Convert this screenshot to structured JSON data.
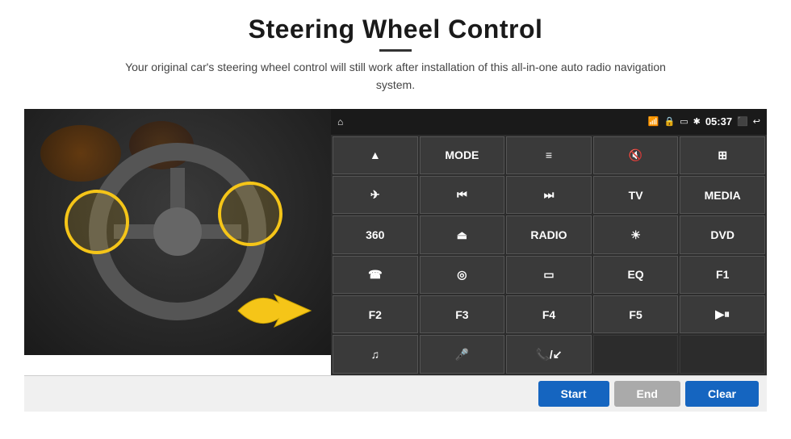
{
  "page": {
    "title": "Steering Wheel Control",
    "subtitle": "Your original car's steering wheel control will still work after installation of this all-in-one auto radio navigation system.",
    "divider": true
  },
  "topbar": {
    "wifi_icon": "wifi",
    "lock_icon": "lock",
    "sim_icon": "sim",
    "bt_icon": "bluetooth",
    "time": "05:37",
    "screen_icon": "screen",
    "back_icon": "back",
    "home_icon": "home"
  },
  "control_buttons": [
    {
      "id": "nav",
      "label": "▲",
      "type": "icon"
    },
    {
      "id": "mode",
      "label": "MODE",
      "type": "text"
    },
    {
      "id": "list",
      "label": "≡",
      "type": "icon"
    },
    {
      "id": "mute",
      "label": "🔇",
      "type": "icon"
    },
    {
      "id": "apps",
      "label": "⊞",
      "type": "icon"
    },
    {
      "id": "back-nav",
      "label": "✈",
      "type": "icon"
    },
    {
      "id": "prev",
      "label": "⏮",
      "type": "icon"
    },
    {
      "id": "next",
      "label": "⏭",
      "type": "icon"
    },
    {
      "id": "tv",
      "label": "TV",
      "type": "text"
    },
    {
      "id": "media",
      "label": "MEDIA",
      "type": "text"
    },
    {
      "id": "cam360",
      "label": "360",
      "type": "text"
    },
    {
      "id": "eject",
      "label": "⏏",
      "type": "icon"
    },
    {
      "id": "radio",
      "label": "RADIO",
      "type": "text"
    },
    {
      "id": "bright",
      "label": "☀",
      "type": "icon"
    },
    {
      "id": "dvd",
      "label": "DVD",
      "type": "text"
    },
    {
      "id": "phone",
      "label": "☎",
      "type": "icon"
    },
    {
      "id": "compass",
      "label": "◎",
      "type": "icon"
    },
    {
      "id": "rect",
      "label": "▭",
      "type": "icon"
    },
    {
      "id": "eq",
      "label": "EQ",
      "type": "text"
    },
    {
      "id": "f1",
      "label": "F1",
      "type": "text"
    },
    {
      "id": "f2",
      "label": "F2",
      "type": "text"
    },
    {
      "id": "f3",
      "label": "F3",
      "type": "text"
    },
    {
      "id": "f4",
      "label": "F4",
      "type": "text"
    },
    {
      "id": "f5",
      "label": "F5",
      "type": "text"
    },
    {
      "id": "playpause",
      "label": "▶⏸",
      "type": "icon"
    },
    {
      "id": "music",
      "label": "♫",
      "type": "icon"
    },
    {
      "id": "mic",
      "label": "🎤",
      "type": "icon"
    },
    {
      "id": "phonecall",
      "label": "📞/↙",
      "type": "icon"
    },
    {
      "id": "empty1",
      "label": "",
      "type": "empty"
    },
    {
      "id": "empty2",
      "label": "",
      "type": "empty"
    }
  ],
  "bottom_buttons": {
    "start": "Start",
    "end": "End",
    "clear": "Clear"
  }
}
